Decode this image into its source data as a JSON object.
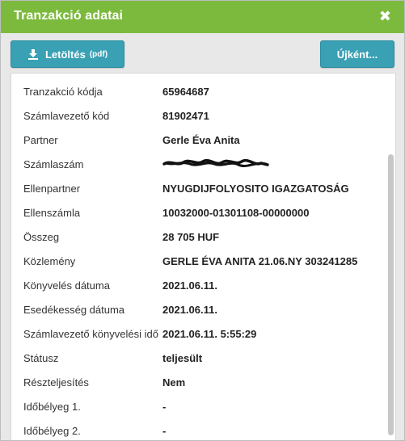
{
  "modal": {
    "title": "Tranzakció adatai",
    "close_glyph": "✖"
  },
  "toolbar": {
    "download_label": "Letöltés",
    "download_format": "(pdf)",
    "new_label": "Újként..."
  },
  "colors": {
    "header": "#7cba3d",
    "button": "#3aa0b4",
    "background": "#e8e8e8"
  },
  "details": {
    "rows": [
      {
        "label": "Tranzakció kódja",
        "value": "65964687"
      },
      {
        "label": "Számlavezető kód",
        "value": "81902471"
      },
      {
        "label": "Partner",
        "value": "Gerle Éva Anita"
      },
      {
        "label": "Számlaszám",
        "value": ""
      },
      {
        "label": "Ellenpartner",
        "value": "NYUGDIJFOLYOSITO IGAZGATOSÁG"
      },
      {
        "label": "Ellenszámla",
        "value": "10032000-01301108-00000000"
      },
      {
        "label": "Összeg",
        "value": "28 705 HUF"
      },
      {
        "label": "Közlemény",
        "value": "GERLE ÉVA ANITA 21.06.NY 303241285"
      },
      {
        "label": "Könyvelés dátuma",
        "value": "2021.06.11."
      },
      {
        "label": "Esedékesség dátuma",
        "value": "2021.06.11."
      },
      {
        "label": "Számlavezető könyvelési idő",
        "value": "2021.06.11. 5:55:29"
      },
      {
        "label": "Státusz",
        "value": "teljesült"
      },
      {
        "label": "Részteljesítés",
        "value": "Nem"
      },
      {
        "label": "Időbélyeg 1.",
        "value": "-"
      },
      {
        "label": "Időbélyeg 2.",
        "value": "-"
      }
    ]
  }
}
